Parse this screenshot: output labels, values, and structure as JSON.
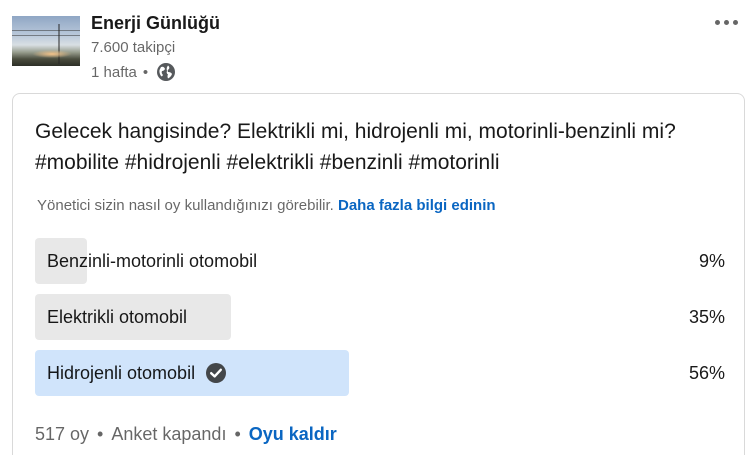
{
  "author": {
    "name": "Enerji Günlüğü",
    "followers": "7.600 takipçi",
    "time": "1 hafta",
    "separator": "•",
    "visibility_icon": "globe-icon"
  },
  "more_icon": "ellipsis-icon",
  "poll": {
    "question": "Gelecek hangisinde? Elektrikli mi, hidrojenli mi, motorinli-benzinli mi? #mobilite #hidrojenli #elektrikli #benzinli #motorinli",
    "visibility_note": "Yönetici sizin nasıl oy kullandığınızı görebilir.",
    "learn_more": "Daha fazla bilgi edinin",
    "options": [
      {
        "label": "Benzinli-motorinli otomobil",
        "percent": "9%",
        "value": 9,
        "selected": false
      },
      {
        "label": "Elektrikli otomobil",
        "percent": "35%",
        "value": 35,
        "selected": false
      },
      {
        "label": "Hidrojenli otomobil",
        "percent": "56%",
        "value": 56,
        "selected": true
      }
    ],
    "votes": "517 oy",
    "separator": "•",
    "status": "Anket kapandı",
    "undo_vote": "Oyu kaldır"
  },
  "colors": {
    "link": "#0a66c2",
    "bar_default": "#e8e8e8",
    "bar_selected": "#d0e4fb",
    "check": "#434649"
  }
}
